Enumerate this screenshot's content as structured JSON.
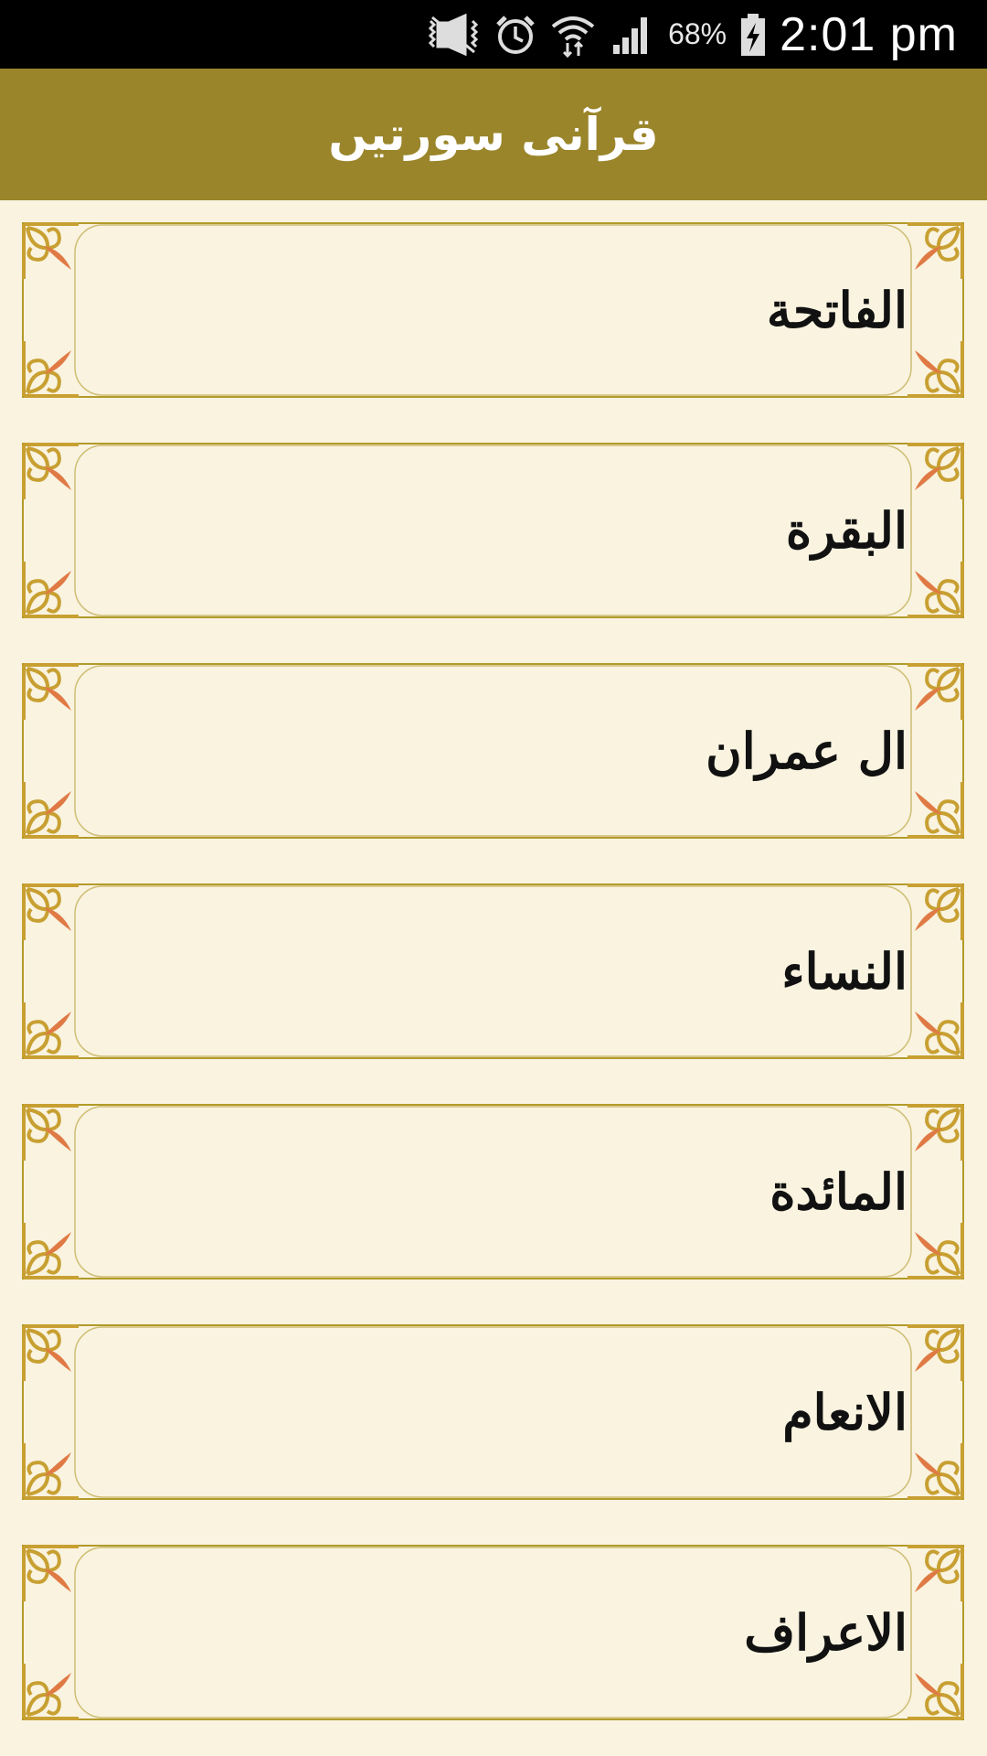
{
  "status_bar": {
    "battery_percent": "68%",
    "time": "2:01 pm",
    "icons": [
      "mute-vibrate-icon",
      "alarm-icon",
      "wifi-icon",
      "signal-icon",
      "battery-charging-icon"
    ]
  },
  "app_bar": {
    "title": "قرآنی سورتیں"
  },
  "colors": {
    "app_bar": "#9a852a",
    "background": "#f9f3e0",
    "frame_border": "#b29b2a",
    "ornament_gold": "#c8a032",
    "ornament_orange": "#e07a45"
  },
  "surahs": [
    {
      "name": "الفاتحة"
    },
    {
      "name": "البقرة"
    },
    {
      "name": "ال عمران"
    },
    {
      "name": "النساء"
    },
    {
      "name": "المائدة"
    },
    {
      "name": "الانعام"
    },
    {
      "name": "الاعراف"
    }
  ]
}
